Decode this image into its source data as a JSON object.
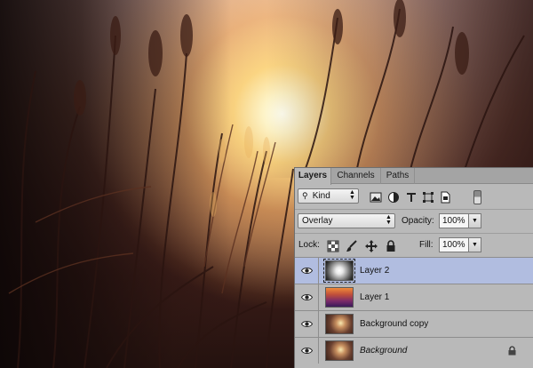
{
  "panel": {
    "tabs": [
      {
        "label": "Layers",
        "active": true
      },
      {
        "label": "Channels",
        "active": false
      },
      {
        "label": "Paths",
        "active": false
      }
    ],
    "filter": {
      "kind_label": "Kind"
    },
    "blend_mode": "Overlay",
    "opacity_label": "Opacity:",
    "opacity_value": "100%",
    "lock_label": "Lock:",
    "fill_label": "Fill:",
    "fill_value": "100%",
    "layers": [
      {
        "name": "Layer 2",
        "selected": true,
        "visible": true,
        "thumb": "white-glow-on-black"
      },
      {
        "name": "Layer 1",
        "selected": false,
        "visible": true,
        "thumb": "purple-orange-gradient"
      },
      {
        "name": "Background copy",
        "selected": false,
        "visible": true,
        "thumb": "photo"
      },
      {
        "name": "Background",
        "selected": false,
        "visible": true,
        "locked": true,
        "italic": true,
        "thumb": "photo"
      }
    ]
  },
  "icons": {
    "filter_icons": [
      "image-filter-icon",
      "adjustment-filter-icon",
      "type-filter-icon",
      "shape-filter-icon",
      "smart-object-filter-icon",
      "filter-toggle-icon"
    ],
    "lock_icons": [
      "lock-transparent-pixels-icon",
      "lock-image-pixels-icon",
      "lock-position-icon",
      "lock-all-icon"
    ]
  },
  "colors": {
    "panel_bg": "#b9b9b9",
    "selected_row": "#b1bde0",
    "tab_bar": "#a4a4a4"
  }
}
